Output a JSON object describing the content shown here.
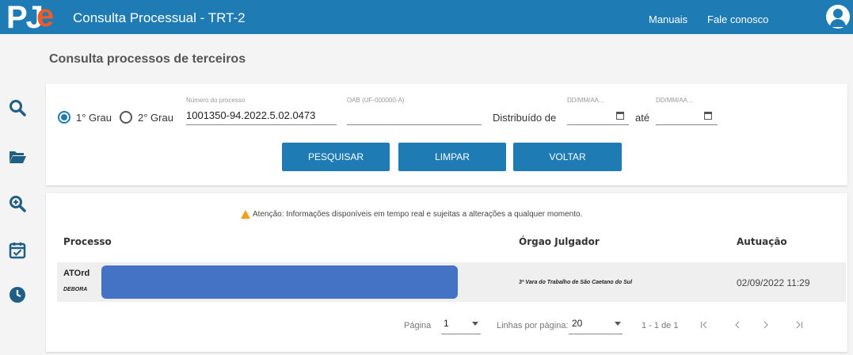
{
  "header": {
    "logo_text_pj": "PJ",
    "logo_text_e": "e",
    "title": "Consulta Processual - TRT-2",
    "links": [
      "Manuais",
      "Fale conosco"
    ]
  },
  "sidebar": {
    "icons": [
      "search-icon",
      "folder-open-icon",
      "zoom-in-icon",
      "calendar-check-icon",
      "clock-icon"
    ]
  },
  "page": {
    "heading": "Consulta processos de terceiros"
  },
  "form": {
    "grau1_label": "1° Grau",
    "grau2_label": "2° Grau",
    "selected_grau": "1° Grau",
    "processo_caption": "Número do processo",
    "processo_value": "1001350-94.2022.5.02.0473",
    "oab_caption": "OAB (UF-000000-A)",
    "oab_value": "",
    "distribuido_label": "Distribuído de",
    "date_caption_from": "DD/MM/AA...",
    "date_caption_to": "DD/MM/AA...",
    "ate_label": "até",
    "buttons": {
      "pesquisar": "PESQUISAR",
      "limpar": "LIMPAR",
      "voltar": "VOLTAR"
    }
  },
  "results": {
    "warning": "Atenção: Informações disponíveis em tempo real e sujeitas a alterações a qualquer momento.",
    "columns": [
      "Processo",
      "Órgao Julgador",
      "Autuação"
    ],
    "rows": [
      {
        "classe": "ATOrd",
        "parte": "DEBORA",
        "orgao": "3ª Vara do Trabalho de São Caetano do Sul",
        "autuacao": "02/09/2022 11:29"
      }
    ],
    "pagination": {
      "page_label": "Página",
      "page_value": "1",
      "rows_label": "Linhas por página:",
      "rows_value": "20",
      "range": "1 - 1 de 1"
    }
  },
  "colors": {
    "topbar": "#1f7bb3",
    "logo_e": "#f05a28",
    "button": "#1f7bb3",
    "redaction": "#4472c4",
    "warning": "#f0a020"
  }
}
